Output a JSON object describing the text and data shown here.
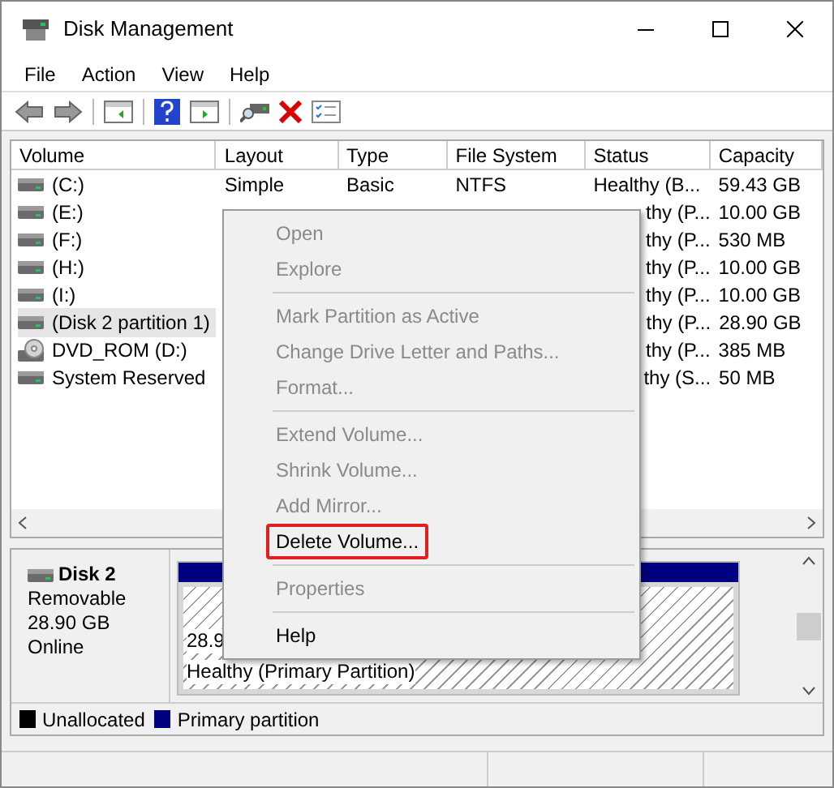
{
  "window": {
    "title": "Disk Management"
  },
  "menu_bar": [
    "File",
    "Action",
    "View",
    "Help"
  ],
  "table": {
    "columns": [
      "Volume",
      "Layout",
      "Type",
      "File System",
      "Status",
      "Capacity"
    ],
    "rows": [
      {
        "kind": "disk",
        "volume": "(C:)",
        "layout": "Simple",
        "type": "Basic",
        "file_system": "NTFS",
        "status": "Healthy (B...",
        "capacity": "59.43 GB",
        "selected": false
      },
      {
        "kind": "disk",
        "volume": "(E:)",
        "status": "thy (P...",
        "capacity": "10.00 GB",
        "selected": false
      },
      {
        "kind": "disk",
        "volume": "(F:)",
        "status": "thy (P...",
        "capacity": "530 MB",
        "selected": false
      },
      {
        "kind": "disk",
        "volume": "(H:)",
        "status": "thy (P...",
        "capacity": "10.00 GB",
        "selected": false
      },
      {
        "kind": "disk",
        "volume": "(I:)",
        "status": "thy (P...",
        "capacity": "10.00 GB",
        "selected": false
      },
      {
        "kind": "disk",
        "volume": "(Disk 2 partition 1)",
        "status": "thy (P...",
        "capacity": "28.90 GB",
        "selected": true
      },
      {
        "kind": "optical",
        "volume": "DVD_ROM (D:)",
        "status": "thy (P...",
        "capacity": "385 MB",
        "selected": false
      },
      {
        "kind": "disk",
        "volume": "System Reserved",
        "status": "thy (S...",
        "capacity": "50 MB",
        "selected": false
      }
    ]
  },
  "disk": {
    "name": "Disk 2",
    "type": "Removable",
    "size": "28.90 GB",
    "state": "Online",
    "partition": {
      "size": "28.9",
      "status": "Healthy (Primary Partition)"
    }
  },
  "legend": [
    {
      "label": "Unallocated",
      "color": "#000000"
    },
    {
      "label": "Primary partition",
      "color": "#000080"
    }
  ],
  "context_menu": [
    {
      "kind": "item",
      "label": "Open",
      "disabled": true,
      "highlighted": false
    },
    {
      "kind": "item",
      "label": "Explore",
      "disabled": true,
      "highlighted": false
    },
    {
      "kind": "separator"
    },
    {
      "kind": "item",
      "label": "Mark Partition as Active",
      "disabled": true,
      "highlighted": false
    },
    {
      "kind": "item",
      "label": "Change Drive Letter and Paths...",
      "disabled": true,
      "highlighted": false
    },
    {
      "kind": "item",
      "label": "Format...",
      "disabled": true,
      "highlighted": false
    },
    {
      "kind": "separator"
    },
    {
      "kind": "item",
      "label": "Extend Volume...",
      "disabled": true,
      "highlighted": false
    },
    {
      "kind": "item",
      "label": "Shrink Volume...",
      "disabled": true,
      "highlighted": false
    },
    {
      "kind": "item",
      "label": "Add Mirror...",
      "disabled": true,
      "highlighted": false
    },
    {
      "kind": "item",
      "label": "Delete Volume...",
      "disabled": false,
      "highlighted": true
    },
    {
      "kind": "separator"
    },
    {
      "kind": "item",
      "label": "Properties",
      "disabled": true,
      "highlighted": false
    },
    {
      "kind": "separator"
    },
    {
      "kind": "item",
      "label": "Help",
      "disabled": false,
      "highlighted": false
    }
  ]
}
